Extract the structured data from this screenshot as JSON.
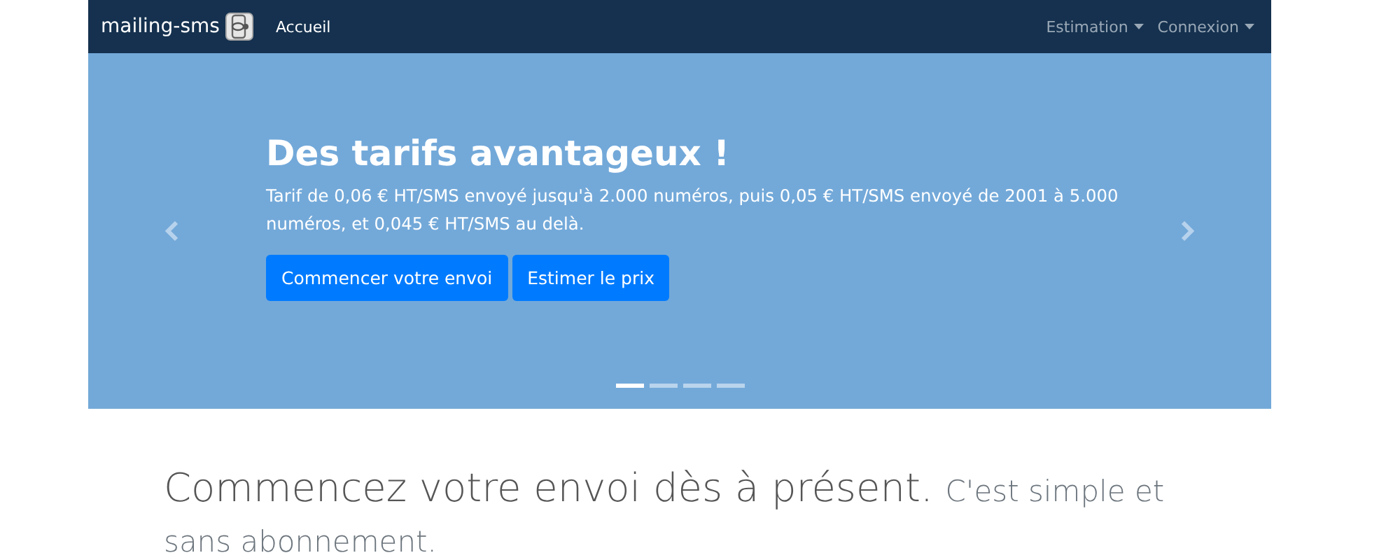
{
  "navbar": {
    "brand": "mailing-sms",
    "links": [
      {
        "label": "Accueil"
      }
    ],
    "dropdowns": [
      {
        "label": "Estimation"
      },
      {
        "label": "Connexion"
      }
    ]
  },
  "carousel": {
    "title": "Des tarifs avantageux !",
    "text": "Tarif de 0,06 € HT/SMS envoyé jusqu'à 2.000 numéros, puis 0,05 € HT/SMS envoyé de 2001 à 5.000 numéros, et 0,045 € HT/SMS au delà.",
    "buttons": [
      "Commencer votre envoi",
      "Estimer le prix"
    ],
    "indicators": [
      {
        "selected": true
      },
      {
        "selected": false
      },
      {
        "selected": false
      },
      {
        "selected": false
      }
    ]
  },
  "intro": {
    "heading": "Commencez votre envoi dès à présent.",
    "subheading": "C'est simple et sans abonnement."
  }
}
